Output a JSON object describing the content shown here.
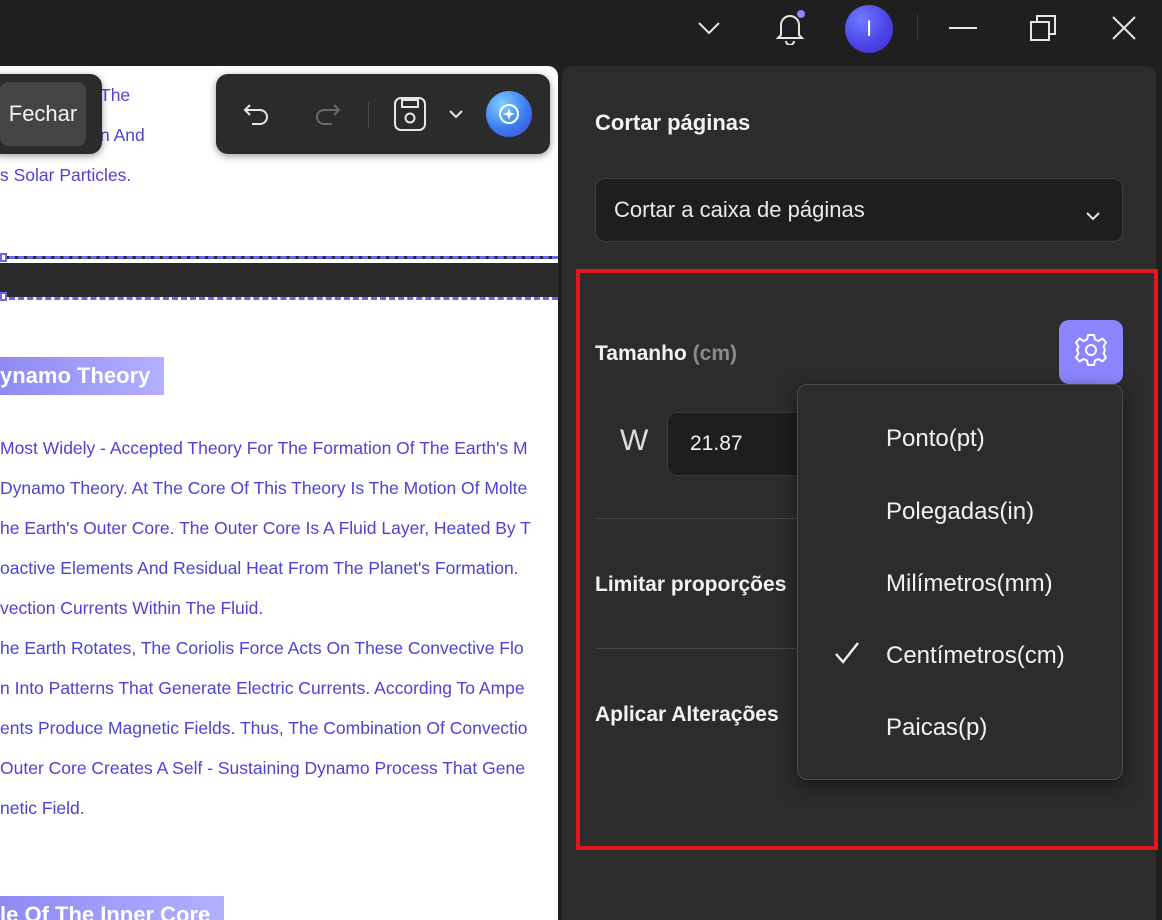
{
  "titlebar": {
    "avatar_letter": "I"
  },
  "toolbar": {
    "close_label": "Fechar"
  },
  "document": {
    "top_lines": [
      "The",
      "n And",
      "s Solar Particles."
    ],
    "heading1": "ynamo Theory",
    "paragraph": [
      "Most Widely - Accepted Theory For The Formation Of The Earth's M",
      "Dynamo Theory. At The Core Of This Theory Is The Motion Of Molte",
      "he Earth's Outer Core. The Outer Core Is A Fluid Layer, Heated By T",
      "oactive Elements And Residual Heat From The Planet's Formation.",
      "vection Currents Within The Fluid.",
      "he Earth Rotates, The Coriolis Force Acts On These Convective Flo",
      "n Into Patterns That Generate Electric Currents. According To Ampe",
      "ents Produce Magnetic Fields. Thus, The Combination Of Convectio",
      "Outer Core Creates A Self - Sustaining Dynamo Process That Gene",
      "netic Field."
    ],
    "heading2": "le Of The Inner Core"
  },
  "panel": {
    "title": "Cortar páginas",
    "crop_select_value": "Cortar a caixa de páginas",
    "size_label": "Tamanho",
    "size_unit": "(cm)",
    "width_label": "W",
    "width_value": "21.87",
    "constrain_label": "Limitar proporções",
    "apply_label": "Aplicar Alterações"
  },
  "unit_menu": {
    "selected": "Centímetros(cm)",
    "options": [
      "Ponto(pt)",
      "Polegadas(in)",
      "Milímetros(mm)",
      "Centímetros(cm)",
      "Paicas(p)"
    ]
  },
  "colors": {
    "accent": "#8b86ff",
    "highlight_border": "#e0171c",
    "doc_text": "#4d43d6"
  }
}
